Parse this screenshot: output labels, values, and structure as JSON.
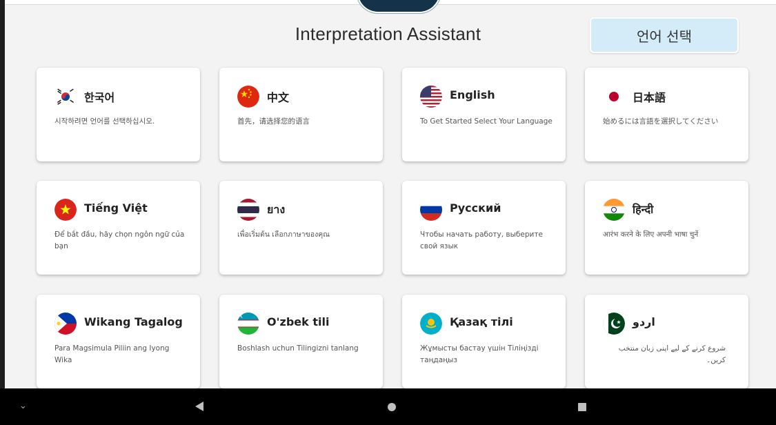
{
  "header": {
    "title": "Interpretation Assistant",
    "language_select_label": "언어 선택"
  },
  "languages": [
    {
      "name": "한국어",
      "subtitle": "시작하려면 언어를 선택하십시오.",
      "flag": "south-korea-flag"
    },
    {
      "name": "中文",
      "subtitle": "首先，请选择您的语言",
      "flag": "china-flag"
    },
    {
      "name": "English",
      "subtitle": "To Get Started Select Your Language",
      "flag": "usa-flag"
    },
    {
      "name": "日本語",
      "subtitle": "始めるには言語を選択してください",
      "flag": "japan-flag"
    },
    {
      "name": "Tiếng Việt",
      "subtitle": "Để bắt đầu, hãy chọn ngôn ngữ của bạn",
      "flag": "vietnam-flag"
    },
    {
      "name": "ยาง",
      "subtitle": "เพื่อเริ่มต้น เลือกภาษาของคุณ",
      "flag": "thailand-flag"
    },
    {
      "name": "Русский",
      "subtitle": "Чтобы начать работу, выберите свой язык",
      "flag": "russia-flag"
    },
    {
      "name": "हिन्दी",
      "subtitle": "आरंभ करने के लिए अपनी भाषा चुनें",
      "flag": "india-flag"
    },
    {
      "name": "Wikang Tagalog",
      "subtitle": "Para Magsimula Piliin ang Iyong Wika",
      "flag": "philippines-flag"
    },
    {
      "name": "O'zbek tili",
      "subtitle": "Boshlash uchun Tilingizni tanlang",
      "flag": "uzbekistan-flag"
    },
    {
      "name": "Қазақ тілі",
      "subtitle": "Жұмысты бастау үшін Тіліңізді таңдаңыз",
      "flag": "kazakhstan-flag"
    },
    {
      "name": "اردو",
      "subtitle": "شروع کرنے کے لیے اپنی زبان منتخب کریں۔",
      "flag": "pakistan-flag"
    }
  ],
  "colors": {
    "background": "#f3f3f3",
    "button_bg": "#d4ebf8",
    "navbar": "#000000"
  },
  "navbar": {
    "icons": [
      "chevron-down-icon",
      "back-icon",
      "home-icon",
      "recents-icon"
    ]
  }
}
